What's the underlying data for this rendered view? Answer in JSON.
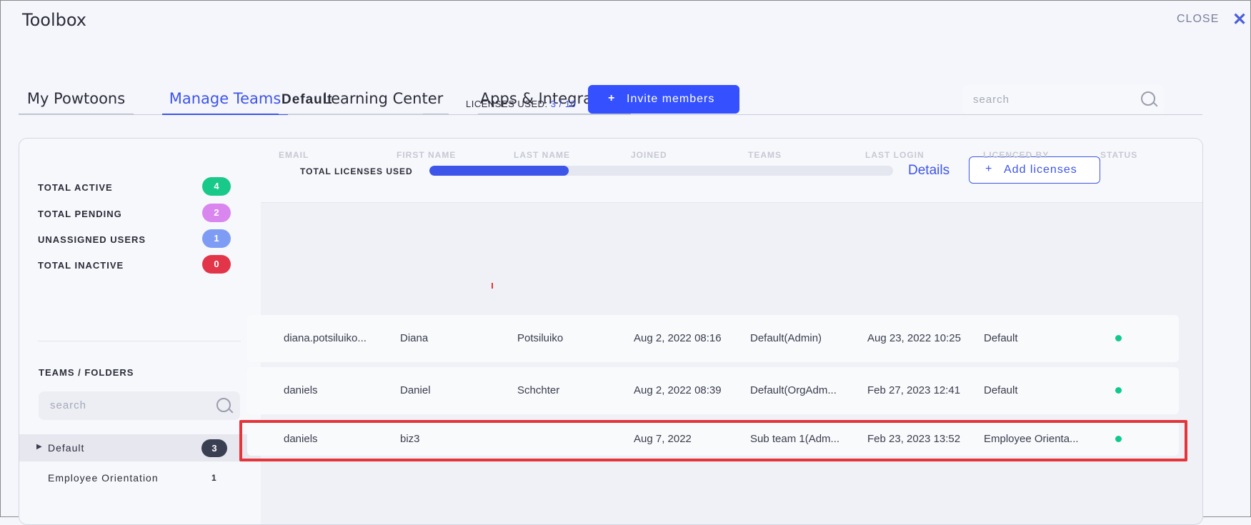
{
  "app": {
    "title": "Toolbox",
    "close_label": "CLOSE"
  },
  "tabs": [
    {
      "label": "My Powtoons"
    },
    {
      "label": "Manage Teams"
    },
    {
      "label": "Learning Center"
    },
    {
      "label": "Apps & Integrations"
    }
  ],
  "stats": [
    {
      "label": "TOTAL ACTIVE",
      "count": "4",
      "color": "#19c98a"
    },
    {
      "label": "TOTAL PENDING",
      "count": "2",
      "color": "#d986ef"
    },
    {
      "label": "UNASSIGNED USERS",
      "count": "1",
      "color": "#7f9cf5"
    },
    {
      "label": "TOTAL INACTIVE",
      "count": "0",
      "color": "#e3354a"
    }
  ],
  "sidebar": {
    "teams_label": "TEAMS / FOLDERS",
    "search_placeholder": "search",
    "teams": [
      {
        "name": "Default",
        "count": "3"
      },
      {
        "name": "Employee Orientation",
        "count": "1"
      }
    ]
  },
  "licenses": {
    "title": "TOTAL LICENSES USED",
    "fraction_used": 0.3,
    "details_label": "Details",
    "add_label": "Add licenses",
    "add_icon": "plus-icon"
  },
  "team": {
    "name": "Default",
    "licenses_label": "LICENSES USED:",
    "licenses_value": "3 / 10",
    "invite_label": "Invite members",
    "search_placeholder": "search"
  },
  "table": {
    "columns": [
      "EMAIL",
      "FIRST NAME",
      "LAST NAME",
      "JOINED",
      "TEAMS",
      "LAST LOGIN",
      "LICENCED BY",
      "STATUS"
    ],
    "rows": [
      {
        "email": "diana.potsiluiko...",
        "first": "Diana",
        "last": "Potsiluiko",
        "joined": "Aug 2, 2022 08:16",
        "teams": "Default(Admin)",
        "last_login": "Aug 23, 2022 10:25",
        "licenced_by": "Default",
        "status": "active"
      },
      {
        "email": "daniels",
        "first": "Daniel",
        "last": "Schchter",
        "joined": "Aug 2, 2022 08:39",
        "teams": "Default(OrgAdm...",
        "last_login": "Feb 27, 2023 12:41",
        "licenced_by": "Default",
        "status": "active"
      },
      {
        "email": "daniels",
        "first": "biz3",
        "last": "",
        "joined": "Aug 7, 2022",
        "teams": "Sub team 1(Adm...",
        "last_login": "Feb 23, 2023 13:52",
        "licenced_by": "Employee Orienta...",
        "status": "active"
      }
    ]
  },
  "colors": {
    "accent": "#3d55e8",
    "status_active": "#10c98f",
    "highlight": "#e3353a"
  }
}
